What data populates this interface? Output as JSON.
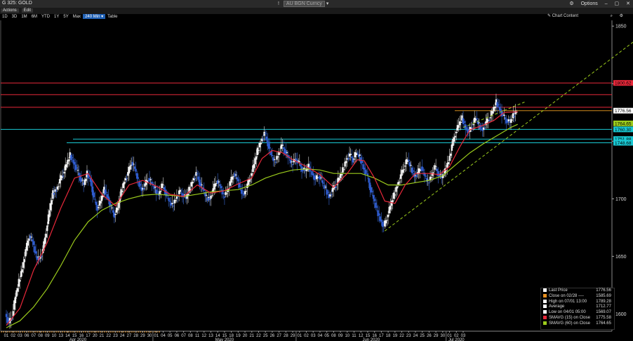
{
  "window": {
    "title": "G 325: GOLD",
    "center_marker": "!",
    "currency_box": "AU BGN Curncy",
    "options": "Options",
    "toolbar_icons": [
      "options-icon",
      "minimize-icon",
      "restore-icon",
      "close-icon"
    ]
  },
  "menu": {
    "actions": "Actions",
    "edit": "Edit"
  },
  "periods": [
    {
      "label": "1D",
      "active": false
    },
    {
      "label": "3D",
      "active": false
    },
    {
      "label": "1M",
      "active": false
    },
    {
      "label": "6M",
      "active": false
    },
    {
      "label": "YTD",
      "active": false
    },
    {
      "label": "1Y",
      "active": false
    },
    {
      "label": "5Y",
      "active": false
    },
    {
      "label": "Max",
      "active": false
    },
    {
      "label": "240 Min",
      "active": true
    },
    {
      "label": "Table",
      "active": false
    }
  ],
  "chart_content_label": "Chart Content",
  "chart_data": {
    "type": "candlestick",
    "title": "",
    "xlabel": "",
    "ylabel": "",
    "ylim": [
      1585,
      1855
    ],
    "y_ticks": [
      1600,
      1650,
      1700,
      1750,
      1800,
      1850
    ],
    "x_day_ticks": [
      "01",
      "02",
      "03",
      "06",
      "07",
      "08",
      "09",
      "10",
      "13",
      "14",
      "15",
      "16",
      "17",
      "20",
      "21",
      "22",
      "23",
      "24",
      "27",
      "28",
      "29",
      "30",
      "01",
      "04",
      "05",
      "06",
      "07",
      "08",
      "11",
      "12",
      "13",
      "14",
      "15",
      "18",
      "19",
      "20",
      "21",
      "22",
      "25",
      "26",
      "27",
      "28",
      "29",
      "01",
      "02",
      "03",
      "04",
      "05",
      "08",
      "09",
      "10",
      "11",
      "12",
      "15",
      "16",
      "17",
      "18",
      "19",
      "22",
      "23",
      "24",
      "25",
      "26",
      "29",
      "30",
      "01",
      "02",
      "03"
    ],
    "x_months": [
      "Apr 2020",
      "May 2020",
      "Jun 2020",
      "Jul 2020"
    ],
    "price_labels": [
      {
        "value": "1800.62",
        "color": "#e8283a"
      },
      {
        "value": "1776.56",
        "color": "#ffffff"
      },
      {
        "value": "1764.65",
        "color": "#9ccc1c"
      },
      {
        "value": "1760.30",
        "color": "#19c9d4"
      },
      {
        "value": "1751.88",
        "color": "#19c9d4"
      },
      {
        "value": "1748.68",
        "color": "#19c9d4"
      }
    ],
    "horizontal_levels": [
      {
        "value": 1800.62,
        "color": "#e8283a"
      },
      {
        "value": 1790.5,
        "color": "#e8283a"
      },
      {
        "value": 1779.5,
        "color": "#e8283a"
      },
      {
        "value": 1760.3,
        "color": "#19c9d4"
      },
      {
        "value": 1751.88,
        "color": "#19c9d4"
      },
      {
        "value": 1748.68,
        "color": "#19c9d4"
      },
      {
        "value": 1776.56,
        "color": "#d08a1c"
      }
    ],
    "close_path": [
      [
        0,
        1600
      ],
      [
        0.5,
        1592
      ],
      [
        1,
        1598
      ],
      [
        1.5,
        1615
      ],
      [
        2,
        1628
      ],
      [
        2.5,
        1640
      ],
      [
        3,
        1655
      ],
      [
        3.5,
        1668
      ],
      [
        4,
        1663
      ],
      [
        4.5,
        1650
      ],
      [
        5,
        1648
      ],
      [
        5.5,
        1655
      ],
      [
        6,
        1672
      ],
      [
        6.5,
        1690
      ],
      [
        7,
        1705
      ],
      [
        7.5,
        1708
      ],
      [
        8,
        1716
      ],
      [
        8.5,
        1722
      ],
      [
        9,
        1730
      ],
      [
        9.5,
        1738
      ],
      [
        10,
        1732
      ],
      [
        10.5,
        1725
      ],
      [
        11,
        1718
      ],
      [
        11.5,
        1712
      ],
      [
        12,
        1722
      ],
      [
        12.5,
        1716
      ],
      [
        13,
        1700
      ],
      [
        13.5,
        1692
      ],
      [
        14,
        1698
      ],
      [
        14.5,
        1708
      ],
      [
        15,
        1702
      ],
      [
        15.5,
        1692
      ],
      [
        16,
        1686
      ],
      [
        16.5,
        1692
      ],
      [
        17,
        1706
      ],
      [
        17.5,
        1716
      ],
      [
        18,
        1722
      ],
      [
        18.5,
        1732
      ],
      [
        19,
        1726
      ],
      [
        19.5,
        1715
      ],
      [
        20,
        1708
      ],
      [
        20.5,
        1712
      ],
      [
        21,
        1718
      ],
      [
        21.5,
        1713
      ],
      [
        22,
        1708
      ],
      [
        22.5,
        1704
      ],
      [
        23,
        1712
      ],
      [
        23.5,
        1706
      ],
      [
        24,
        1698
      ],
      [
        24.5,
        1694
      ],
      [
        25,
        1700
      ],
      [
        25.5,
        1706
      ],
      [
        26,
        1704
      ],
      [
        26.5,
        1700
      ],
      [
        27,
        1708
      ],
      [
        27.5,
        1716
      ],
      [
        28,
        1722
      ],
      [
        28.5,
        1714
      ],
      [
        29,
        1708
      ],
      [
        29.5,
        1701
      ],
      [
        30,
        1700
      ],
      [
        30.5,
        1708
      ],
      [
        31,
        1716
      ],
      [
        31.5,
        1711
      ],
      [
        32,
        1702
      ],
      [
        32.5,
        1706
      ],
      [
        33,
        1714
      ],
      [
        33.5,
        1722
      ],
      [
        34,
        1717
      ],
      [
        34.5,
        1708
      ],
      [
        35,
        1704
      ],
      [
        35.5,
        1712
      ],
      [
        36,
        1720
      ],
      [
        36.5,
        1730
      ],
      [
        37,
        1742
      ],
      [
        37.5,
        1750
      ],
      [
        38,
        1757
      ],
      [
        38.5,
        1748
      ],
      [
        39,
        1738
      ],
      [
        39.5,
        1732
      ],
      [
        40,
        1738
      ],
      [
        40.5,
        1746
      ],
      [
        41,
        1742
      ],
      [
        41.5,
        1736
      ],
      [
        42,
        1730
      ],
      [
        42.5,
        1735
      ],
      [
        43,
        1732
      ],
      [
        43.5,
        1726
      ],
      [
        44,
        1724
      ],
      [
        44.5,
        1728
      ],
      [
        45,
        1722
      ],
      [
        45.5,
        1717
      ],
      [
        46,
        1720
      ],
      [
        46.5,
        1714
      ],
      [
        47,
        1708
      ],
      [
        47.5,
        1702
      ],
      [
        48,
        1708
      ],
      [
        48.5,
        1712
      ],
      [
        49,
        1718
      ],
      [
        49.5,
        1725
      ],
      [
        50,
        1734
      ],
      [
        50.5,
        1738
      ],
      [
        51,
        1734
      ],
      [
        51.5,
        1740
      ],
      [
        52,
        1736
      ],
      [
        52.5,
        1727
      ],
      [
        53,
        1722
      ],
      [
        53.5,
        1710
      ],
      [
        54,
        1700
      ],
      [
        54.5,
        1690
      ],
      [
        55,
        1682
      ],
      [
        55.5,
        1676
      ],
      [
        56,
        1684
      ],
      [
        56.5,
        1694
      ],
      [
        57,
        1703
      ],
      [
        57.5,
        1712
      ],
      [
        58,
        1720
      ],
      [
        58.5,
        1728
      ],
      [
        59,
        1734
      ],
      [
        59.5,
        1727
      ],
      [
        60,
        1720
      ],
      [
        60.5,
        1722
      ],
      [
        61,
        1728
      ],
      [
        61.5,
        1720
      ],
      [
        62,
        1714
      ],
      [
        62.5,
        1720
      ],
      [
        63,
        1728
      ],
      [
        63.5,
        1722
      ],
      [
        64,
        1718
      ],
      [
        64.5,
        1724
      ],
      [
        65,
        1733
      ],
      [
        65.5,
        1746
      ],
      [
        66,
        1757
      ],
      [
        66.5,
        1764
      ],
      [
        67,
        1770
      ],
      [
        67.5,
        1762
      ],
      [
        68,
        1758
      ],
      [
        68.5,
        1764
      ],
      [
        69,
        1770
      ],
      [
        69.5,
        1764
      ],
      [
        70,
        1760
      ],
      [
        70.5,
        1766
      ],
      [
        71,
        1770
      ],
      [
        71.5,
        1776
      ],
      [
        72,
        1784
      ],
      [
        72.5,
        1778
      ],
      [
        73,
        1772
      ],
      [
        73.5,
        1768
      ],
      [
        74,
        1766
      ],
      [
        74.5,
        1772
      ],
      [
        75,
        1776.56
      ]
    ],
    "sma15": [
      [
        0,
        1590
      ],
      [
        2,
        1605
      ],
      [
        4,
        1638
      ],
      [
        6,
        1662
      ],
      [
        8,
        1692
      ],
      [
        10,
        1718
      ],
      [
        12,
        1722
      ],
      [
        14,
        1704
      ],
      [
        16,
        1694
      ],
      [
        18,
        1712
      ],
      [
        20,
        1716
      ],
      [
        22,
        1711
      ],
      [
        24,
        1704
      ],
      [
        26,
        1702
      ],
      [
        28,
        1712
      ],
      [
        30,
        1705
      ],
      [
        32,
        1707
      ],
      [
        34,
        1713
      ],
      [
        36,
        1718
      ],
      [
        37.5,
        1735
      ],
      [
        39,
        1742
      ],
      [
        40.5,
        1740
      ],
      [
        42,
        1734
      ],
      [
        44,
        1728
      ],
      [
        46,
        1721
      ],
      [
        48,
        1710
      ],
      [
        50,
        1722
      ],
      [
        51.5,
        1734
      ],
      [
        52.5,
        1733
      ],
      [
        54,
        1718
      ],
      [
        55.5,
        1698
      ],
      [
        57,
        1696
      ],
      [
        58.5,
        1712
      ],
      [
        60,
        1722
      ],
      [
        62,
        1722
      ],
      [
        63.5,
        1721
      ],
      [
        65,
        1728
      ],
      [
        66.5,
        1745
      ],
      [
        68,
        1760
      ],
      [
        70,
        1764
      ],
      [
        71.5,
        1768
      ],
      [
        73,
        1775
      ],
      [
        75,
        1775.58
      ]
    ],
    "sma60": [
      [
        0,
        1588
      ],
      [
        2,
        1594
      ],
      [
        4,
        1606
      ],
      [
        6,
        1622
      ],
      [
        8,
        1642
      ],
      [
        10,
        1664
      ],
      [
        12,
        1680
      ],
      [
        14,
        1690
      ],
      [
        16,
        1696
      ],
      [
        18,
        1700
      ],
      [
        20,
        1703
      ],
      [
        22,
        1704
      ],
      [
        24,
        1703
      ],
      [
        26,
        1702
      ],
      [
        28,
        1704
      ],
      [
        30,
        1706
      ],
      [
        32,
        1707
      ],
      [
        34,
        1708
      ],
      [
        36,
        1712
      ],
      [
        38,
        1718
      ],
      [
        40,
        1722
      ],
      [
        42,
        1725
      ],
      [
        44,
        1726
      ],
      [
        46,
        1725
      ],
      [
        48,
        1722
      ],
      [
        50,
        1722
      ],
      [
        52,
        1722
      ],
      [
        54,
        1718
      ],
      [
        56,
        1712
      ],
      [
        58,
        1712
      ],
      [
        60,
        1714
      ],
      [
        62,
        1716
      ],
      [
        64,
        1720
      ],
      [
        66,
        1730
      ],
      [
        68,
        1740
      ],
      [
        70,
        1748
      ],
      [
        72,
        1755
      ],
      [
        74,
        1762
      ],
      [
        75,
        1764.65
      ]
    ],
    "uptrend_dashed": {
      "x": [
        55.5,
        95
      ],
      "y": [
        1672,
        1850
      ]
    },
    "legend": [
      {
        "label": "Last Price",
        "value": "1776.56",
        "color": "#ffffff"
      },
      {
        "label": "Close on 02/28 ----",
        "value": "1585.69",
        "color": "#e89020"
      },
      {
        "label": "High on 07/01 13:00",
        "value": "1789.28",
        "color": "#ffffff"
      },
      {
        "label": "Average",
        "value": "1712.77",
        "color": "#ffffff"
      },
      {
        "label": "Low on 04/01 05:00",
        "value": "1569.07",
        "color": "#ffffff"
      },
      {
        "label": "SMAVG (15)  on Close",
        "value": "1775.58",
        "color": "#e8283a"
      },
      {
        "label": "SMAVG (60)  on Close",
        "value": "1764.65",
        "color": "#9ccc1c"
      }
    ]
  }
}
